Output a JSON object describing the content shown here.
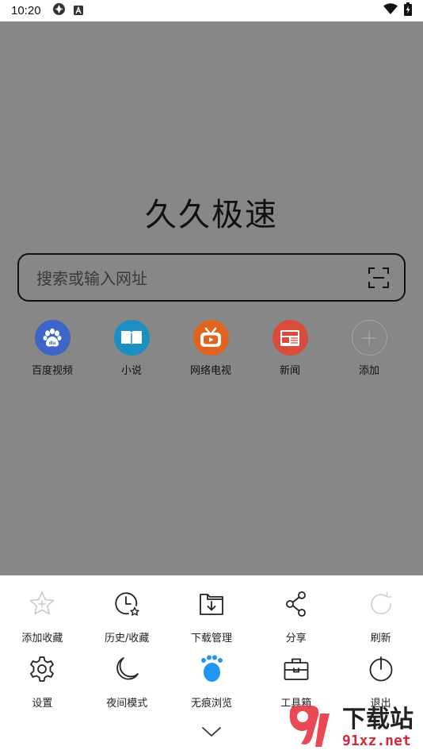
{
  "status_bar": {
    "time": "10:20"
  },
  "home": {
    "title": "久久极速",
    "search": {
      "placeholder": "搜索或输入网址"
    },
    "shortcuts": [
      {
        "label": "百度视频",
        "icon": "baidu-paw-icon",
        "color": "#3d64c6"
      },
      {
        "label": "小说",
        "icon": "book-icon",
        "color": "#1b8fc2"
      },
      {
        "label": "网络电视",
        "icon": "tv-icon",
        "color": "#e0641e"
      },
      {
        "label": "新闻",
        "icon": "newspaper-icon",
        "color": "#d94b3b"
      },
      {
        "label": "添加",
        "icon": "plus-icon",
        "color": "#9a9a9a"
      }
    ]
  },
  "menu": {
    "row1": [
      {
        "label": "添加收藏",
        "icon": "star-add-icon"
      },
      {
        "label": "历史/收藏",
        "icon": "history-clock-icon"
      },
      {
        "label": "下载管理",
        "icon": "download-folder-icon"
      },
      {
        "label": "分享",
        "icon": "share-icon"
      },
      {
        "label": "刷新",
        "icon": "refresh-icon"
      }
    ],
    "row2": [
      {
        "label": "设置",
        "icon": "gear-icon"
      },
      {
        "label": "夜间模式",
        "icon": "moon-icon"
      },
      {
        "label": "无痕浏览",
        "icon": "paw-incognito-icon",
        "color": "#2196f3"
      },
      {
        "label": "工具箱",
        "icon": "toolbox-icon"
      },
      {
        "label": "退出",
        "icon": "power-icon"
      }
    ]
  },
  "watermark": {
    "top_text": "下载站",
    "bottom_text": "91xz.net"
  }
}
